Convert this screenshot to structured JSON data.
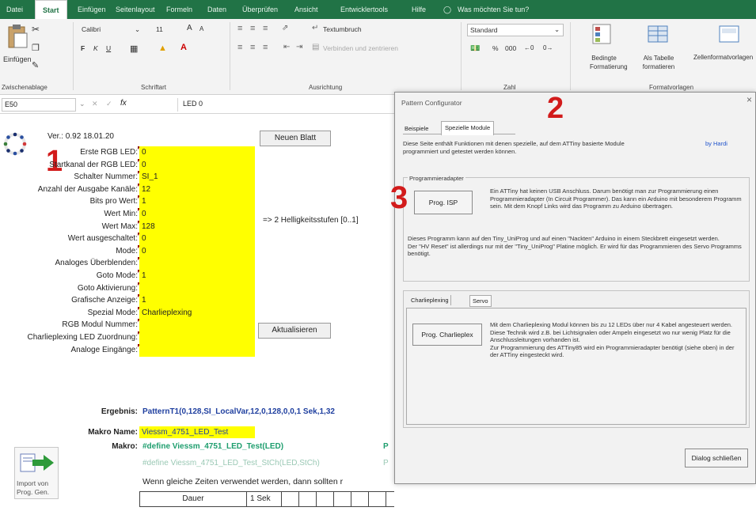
{
  "ribbon": {
    "tabs": [
      "Datei",
      "Start",
      "Einfügen",
      "Seitenlayout",
      "Formeln",
      "Daten",
      "Überprüfen",
      "Ansicht",
      "Entwicklertools",
      "Hilfe",
      "Was möchten Sie tun?"
    ],
    "paste_label": "Einfügen",
    "font_name": "Calibri",
    "font_size": "11",
    "font_size_up": "A",
    "font_size_down": "A",
    "bold": "F",
    "italic": "K",
    "underline": "U",
    "wrap_text": "Textumbruch",
    "merge_center": "Verbinden und zentrieren",
    "number_format": "Standard",
    "percent": "%",
    "thousands": "000",
    "cond_format": "Bedingte Formatierung",
    "as_table": "Als Tabelle formatieren",
    "cell_styles": "Zellenformatvorlagen",
    "groups": [
      "Zwischenablage",
      "Schriftart",
      "Ausrichtung",
      "Zahl",
      "Formatvorlagen"
    ]
  },
  "formula_bar": {
    "name_box": "E50",
    "fx": "fx",
    "value": "LED 0"
  },
  "version": "Ver.: 0.92  18.01.20",
  "buttons": {
    "new_sheet": "Neuen Blatt",
    "refresh": "Aktualisieren",
    "import": "Import von Prog. Gen."
  },
  "fields": [
    {
      "label": "Erste RGB LED:",
      "value": "0"
    },
    {
      "label": "Startkanal der RGB LED:",
      "value": "0"
    },
    {
      "label": "Schalter Nummer:",
      "value": "SI_1"
    },
    {
      "label": "Anzahl der Ausgabe Kanäle:",
      "value": "12"
    },
    {
      "label": "Bits pro Wert:",
      "value": "1"
    },
    {
      "label": "Wert Min:",
      "value": "0"
    },
    {
      "label": "Wert Max:",
      "value": "128"
    },
    {
      "label": "Wert ausgeschaltet:",
      "value": "0"
    },
    {
      "label": "Mode:",
      "value": "0"
    },
    {
      "label": "Analoges Überblenden:",
      "value": ""
    },
    {
      "label": "Goto Mode:",
      "value": "1"
    },
    {
      "label": "Goto Aktivierung:",
      "value": ""
    },
    {
      "label": "Grafische Anzeige:",
      "value": "1"
    },
    {
      "label": "Spezial Mode:",
      "value": "Charlieplexing"
    },
    {
      "label": "RGB Modul Nummer:",
      "value": ""
    },
    {
      "label": "Charlieplexing LED Zuordnung:",
      "value": ""
    },
    {
      "label": "Analoge Eingänge:",
      "value": ""
    }
  ],
  "bits_note": "=> 2 Helligkeitsstufen [0..1]",
  "ergebnis": {
    "label": "Ergebnis:",
    "value": "PatternT1(0,128,SI_LocalVar,12,0,128,0,0,1 Sek,1,32"
  },
  "makro_name": {
    "label": "Makro Name:",
    "value": "Viessm_4751_LED_Test"
  },
  "makro": {
    "label": "Makro:",
    "value": "#define Viessm_4751_LED_Test(LED)",
    "trailing": "P"
  },
  "define_line": {
    "value": "#define Viessm_4751_LED_Test_StCh(LED,StCh)",
    "trailing": "P"
  },
  "hint": "Wenn gleiche Zeiten verwendet werden, dann sollten r",
  "table": {
    "dauer_label": "Dauer",
    "dauer_value": "1 Sek"
  },
  "annotations": [
    "1",
    "2",
    "3"
  ],
  "dialog": {
    "title": "Pattern Configurator",
    "tabs": [
      "Beispiele",
      "Spezielle Module"
    ],
    "intro": "Diese Seite enthält Funktionen mit denen spezielle, auf dem ATTiny basierte Module programmiert und getestet werden können.",
    "author": "by Hardi",
    "prog_frame_title": "Programmieradapter",
    "prog_isp_button": "Prog. ISP",
    "prog_isp_text": "Ein ATTiny hat keinen USB Anschluss. Darum benötigt man zur Programmierung einen Programmieradapter (In Circuit Programmer). Das kann ein Arduino mit besonderem Programm sein. Mit dem Knopf Links wird das Programm zu Arduino übertragen.",
    "prog_note": "Dieses Programm kann auf den Tiny_UniProg und auf einen \"Nackten\" Arduino in einem Steckbrett eingesetzt werden.\nDer \"HV Reset\" ist allerdings nur mit der \"Tiny_UniProg\" Platine möglich. Er wird für das Programmieren des Servo Programms benötigt.",
    "sub_tabs": [
      "Charlieplexing",
      "Servo"
    ],
    "charlie_button": "Prog. Charlieplex",
    "charlie_text": "Mit dem Charlieplexing Modul können bis zu 12 LEDs über nur 4 Kabel angesteuert werden. Diese Technik wird z.B. bei Lichtsignalen oder Ampeln eingesetzt wo nur wenig Platz für die Anschlussleitungen vorhanden ist.\nZur Programmierung des ATTiny85 wird ein Programmieradapter benötigt (siehe oben) in der der ATTiny eingesteckt wird.",
    "close_button": "Dialog schließen",
    "close_x": "×"
  },
  "colors": {
    "excel_green": "#217346",
    "highlight_yellow": "#ffff00",
    "annotation_red": "#d21b1b",
    "macro_blue": "#1f3f9f",
    "macro_green": "#1e9e6e"
  }
}
